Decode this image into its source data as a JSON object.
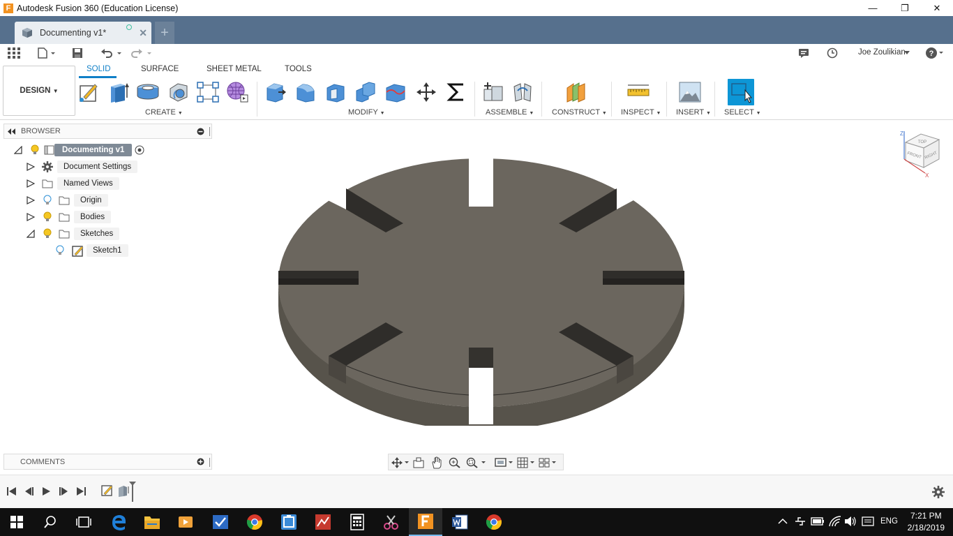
{
  "window": {
    "title": "Autodesk Fusion 360 (Education License)",
    "app_icon_letter": "F",
    "controls": [
      "minimize",
      "restore",
      "close"
    ]
  },
  "tab": {
    "name": "Documenting v1*",
    "new_tab_symbol": "+"
  },
  "quick_access": {
    "user": "Joe Zoulikian"
  },
  "ribbon": {
    "workspace": "DESIGN",
    "tabs": [
      "SOLID",
      "SURFACE",
      "SHEET METAL",
      "TOOLS"
    ],
    "active_tab": "SOLID",
    "groups": {
      "create": "CREATE",
      "modify": "MODIFY",
      "assemble": "ASSEMBLE",
      "construct": "CONSTRUCT",
      "inspect": "INSPECT",
      "insert": "INSERT",
      "select": "SELECT"
    }
  },
  "browser": {
    "header": "BROWSER",
    "root": "Documenting v1",
    "items": [
      {
        "label": "Document Settings",
        "icon": "gear-icon"
      },
      {
        "label": "Named Views",
        "icon": "folder-icon"
      },
      {
        "label": "Origin",
        "icon": "folder-icon"
      },
      {
        "label": "Bodies",
        "icon": "folder-icon"
      },
      {
        "label": "Sketches",
        "icon": "folder-icon"
      },
      {
        "label": "Sketch1",
        "icon": "sketch-icon"
      }
    ]
  },
  "comments": {
    "label": "COMMENTS"
  },
  "viewcube": {
    "top": "TOP",
    "front": "FRONT",
    "right": "RIGHT",
    "z": "Z",
    "x": "X"
  },
  "taskbar": {
    "language": "ENG",
    "time": "7:21 PM",
    "date": "2/18/2019"
  },
  "colors": {
    "tab_strip": "#56708d",
    "accent": "#0f7fc7",
    "model_face": "#6b665e",
    "model_side": "#57534b",
    "slot_shadow": "#2f2d2a"
  }
}
